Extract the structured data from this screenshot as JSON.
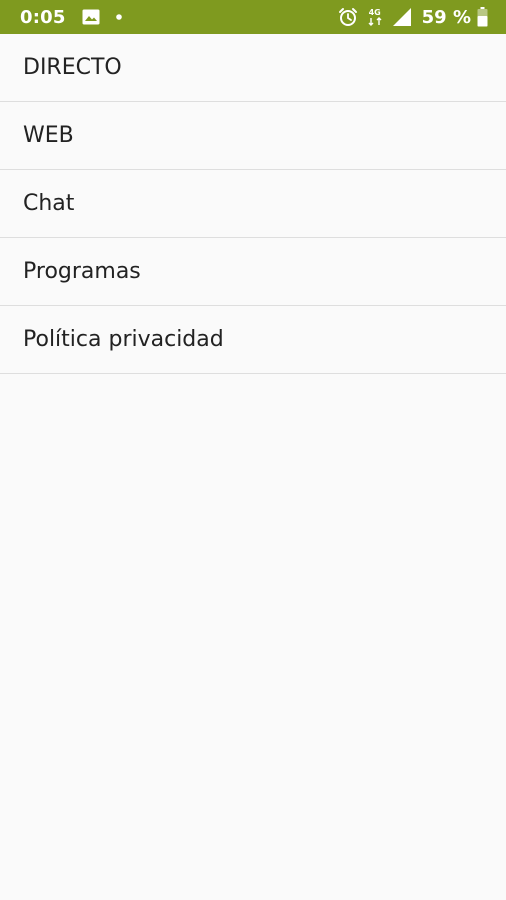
{
  "status_bar": {
    "time": "0:05",
    "network": "4G",
    "battery": "59 %",
    "icons": [
      "image-icon",
      "notification-dot-icon",
      "alarm-icon",
      "network-4g-icon",
      "signal-icon",
      "battery-icon"
    ],
    "background_color": "#7f9a1f"
  },
  "menu": {
    "items": [
      {
        "label": "DIRECTO"
      },
      {
        "label": "WEB"
      },
      {
        "label": "Chat"
      },
      {
        "label": "Programas"
      },
      {
        "label": "Política privacidad"
      }
    ]
  }
}
